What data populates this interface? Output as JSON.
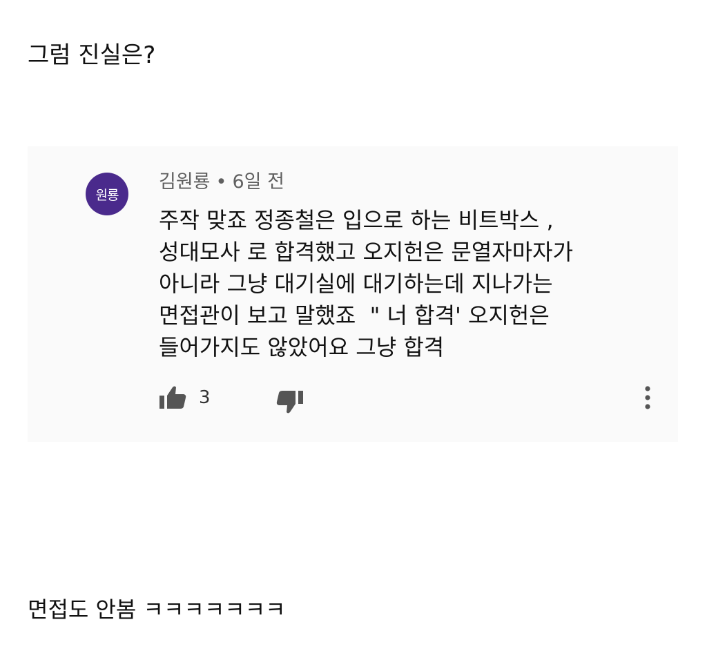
{
  "post": {
    "heading": "그럼 진실은?",
    "footer": "면접도 안봄 ㅋㅋㅋㅋㅋㅋㅋ"
  },
  "comment": {
    "avatar_text": "원룡",
    "author": "김원룡",
    "separator": "•",
    "time": "6일 전",
    "body_lines": [
      "주작 맞죠 정종철은 입으로 하는 비트박스 ,",
      "성대모사 로 합격했고 오지헌은 문열자마자가",
      "아니라 그냥 대기실에 대기하는데 지나가는",
      "면접관이 보고 말했죠  \" 너 합격' 오지헌은",
      "들어가지도 않았어요 그냥 합격"
    ],
    "like_count": "3",
    "icons": {
      "like": "thumbs-up-icon",
      "dislike": "thumbs-down-icon",
      "more": "more-vert-icon"
    }
  },
  "colors": {
    "avatar_bg": "#4a2a8c",
    "card_bg": "#fafafa",
    "meta_text": "#606060",
    "icon": "#555555"
  }
}
